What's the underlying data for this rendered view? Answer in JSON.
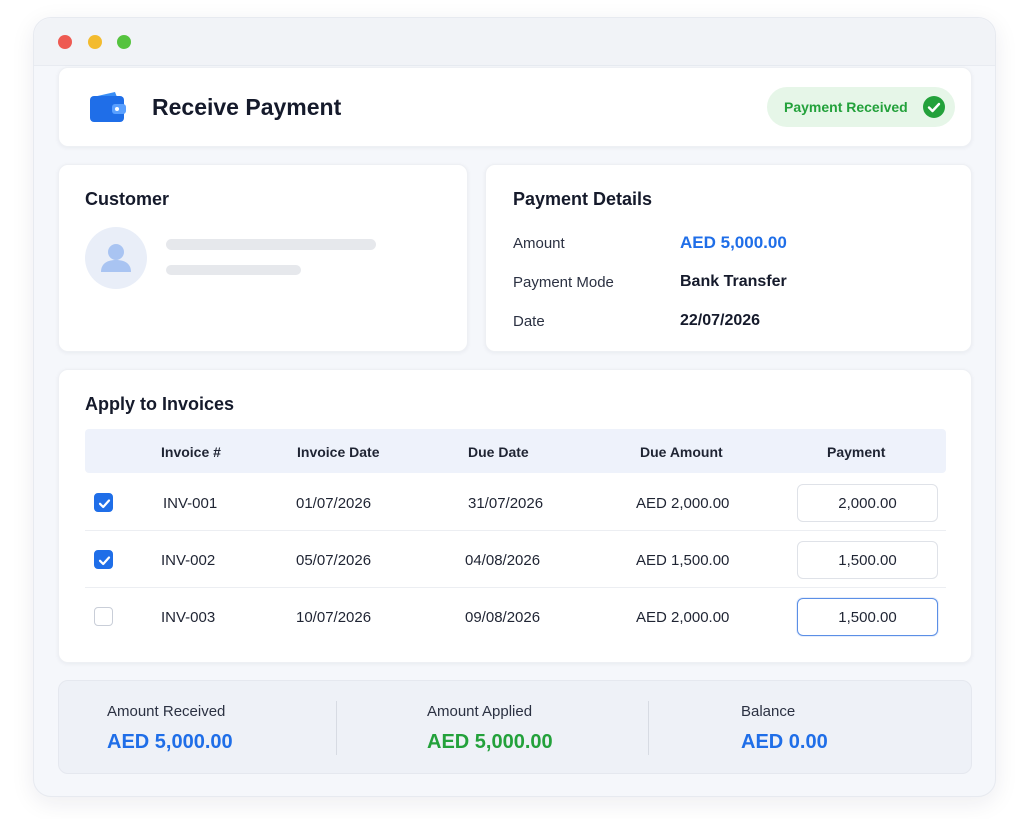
{
  "header": {
    "title": "Receive Payment",
    "status": "Payment Received",
    "icon": "wallet-icon",
    "status_icon": "check-circle-icon"
  },
  "customer": {
    "title": "Customer",
    "avatar_icon": "user-icon"
  },
  "payment_details": {
    "title": "Payment Details",
    "rows": [
      {
        "label": "Amount",
        "value": "AED 5,000.00"
      },
      {
        "label": "Payment Mode",
        "value": "Bank Transfer"
      },
      {
        "label": "Date",
        "value": "22/07/2026"
      }
    ]
  },
  "invoices": {
    "title": "Apply to Invoices",
    "columns": [
      "Invoice #",
      "Invoice Date",
      "Due Date",
      "Due Amount",
      "Payment"
    ],
    "rows": [
      {
        "checked": true,
        "invoice": "INV-001",
        "invoice_date": "01/07/2026",
        "due_date": "31/07/2026",
        "due_amount": "AED 2,000.00",
        "payment": "2,000.00"
      },
      {
        "checked": true,
        "invoice": "INV-002",
        "invoice_date": "05/07/2026",
        "due_date": "04/08/2026",
        "due_amount": "AED 1,500.00",
        "payment": "1,500.00"
      },
      {
        "checked": false,
        "invoice": "INV-003",
        "invoice_date": "10/07/2026",
        "due_date": "09/08/2026",
        "due_amount": "AED 2,000.00",
        "payment": "1,500.00"
      }
    ]
  },
  "summary": {
    "amount_received": {
      "label": "Amount Received",
      "value": "AED 5,000.00"
    },
    "amount_applied": {
      "label": "Amount Applied",
      "value": "AED 5,000.00"
    },
    "balance": {
      "label": "Balance",
      "value": "AED 0.00"
    }
  },
  "colors": {
    "accent_blue": "#1f6ee8",
    "success_green": "#23a13b",
    "status_bg": "#e6f6e8"
  }
}
